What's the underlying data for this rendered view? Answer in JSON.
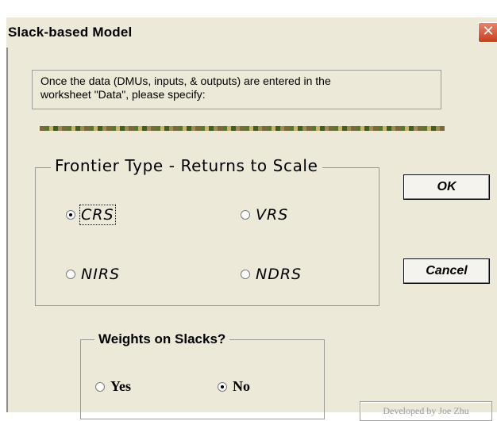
{
  "window": {
    "title": "Slack-based Model",
    "close_glyph": "✕"
  },
  "info": {
    "line1": "Once the data (DMUs, inputs, & outputs) are entered in the",
    "line2": "worksheet \"Data\", please specify:"
  },
  "frontier": {
    "legend": "Frontier Type - Returns to Scale",
    "options": [
      {
        "label": "CRS",
        "selected": true
      },
      {
        "label": "VRS",
        "selected": false
      },
      {
        "label": "NIRS",
        "selected": false
      },
      {
        "label": "NDRS",
        "selected": false
      }
    ]
  },
  "weights": {
    "legend": "Weights on Slacks?",
    "options": [
      {
        "label": "Yes",
        "selected": false
      },
      {
        "label": "No",
        "selected": true
      }
    ]
  },
  "buttons": {
    "ok": "OK",
    "cancel": "Cancel"
  },
  "credit": "Developed by Joe Zhu",
  "colors": {
    "dialog_bg": "#ece9d8",
    "close_red": "#c4401f"
  }
}
